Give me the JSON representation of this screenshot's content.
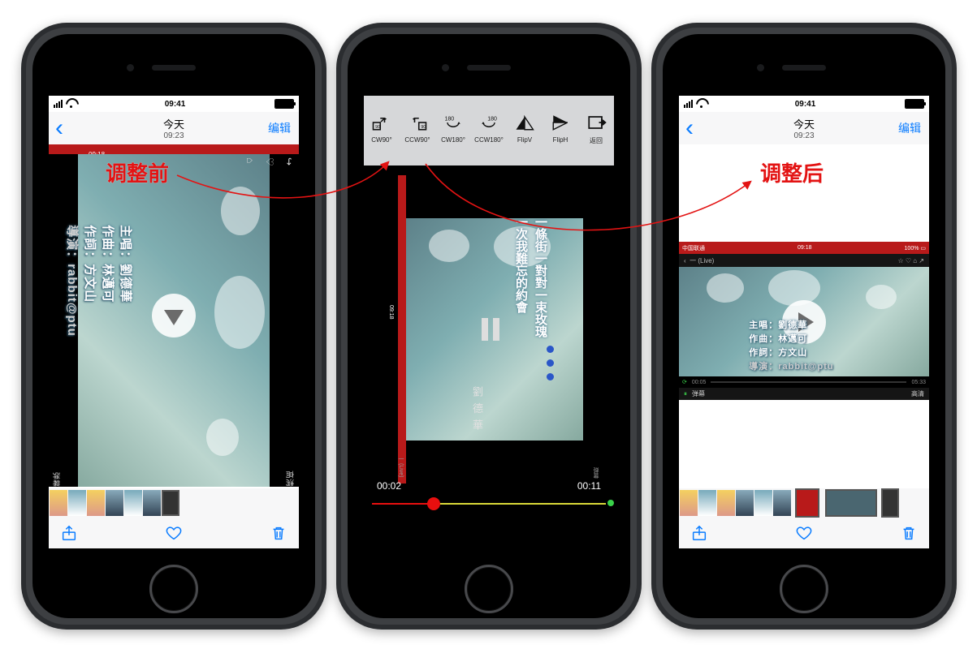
{
  "statusbar": {
    "time": "09:41"
  },
  "navbar": {
    "title1": "今天",
    "title2": "09:23",
    "edit": "编辑"
  },
  "rotation_toolbar": {
    "cw90": "CW90°",
    "ccw90": "CCW90°",
    "cw180": "CW180°",
    "ccw180": "CCW180°",
    "flipv": "FlipV",
    "fliph": "FlipH",
    "back": "返回"
  },
  "scrubber": {
    "current": "00:02",
    "end": "00:11"
  },
  "mv": {
    "credits": {
      "singer": "主唱：劉德華",
      "composer": "作曲：林邁可",
      "lyrics": "作詞：方文山",
      "director": "導演：rabbit@ptu"
    },
    "lyric1": "一條街一對對一束玫瑰",
    "lyric2": "一次我難忘的約會",
    "artist": "劉 德 華",
    "side_time": "09:18",
    "carrier": "中国联通",
    "live": "一 (Live)",
    "hq": "高清",
    "danmu": "弹幕",
    "p3_t0": "00:05",
    "p3_t1": "05:33",
    "batt100": "100%"
  },
  "annotations": {
    "before": "调整前",
    "after": "调整后"
  }
}
